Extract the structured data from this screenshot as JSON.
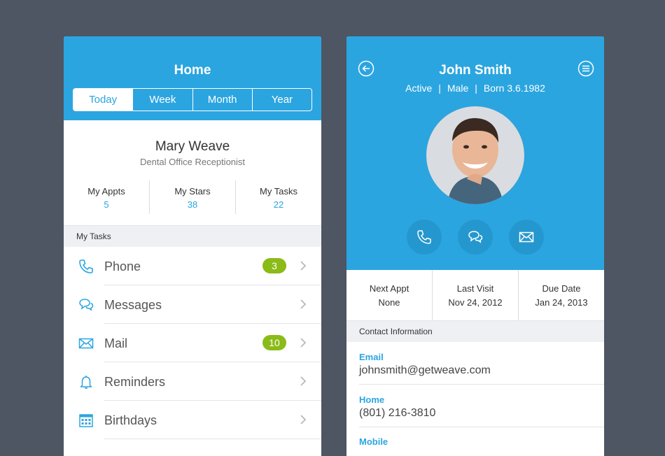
{
  "colors": {
    "background": "#4e5563",
    "accent": "#2ba5e0",
    "badge": "#8bbb18"
  },
  "left": {
    "title": "Home",
    "segments": [
      "Today",
      "Week",
      "Month",
      "Year"
    ],
    "profile": {
      "name": "Mary Weave",
      "role": "Dental Office Receptionist"
    },
    "stats": [
      {
        "label": "My Appts",
        "value": "5"
      },
      {
        "label": "My Stars",
        "value": "38"
      },
      {
        "label": "My Tasks",
        "value": "22"
      }
    ],
    "section_title": "My Tasks",
    "tasks": [
      {
        "icon": "phone-icon",
        "label": "Phone",
        "badge": "3"
      },
      {
        "icon": "messages-icon",
        "label": "Messages",
        "badge": ""
      },
      {
        "icon": "mail-icon",
        "label": "Mail",
        "badge": "10"
      },
      {
        "icon": "bell-icon",
        "label": "Reminders",
        "badge": ""
      },
      {
        "icon": "calendar-icon",
        "label": "Birthdays",
        "badge": ""
      }
    ]
  },
  "right": {
    "name": "John Smith",
    "status": "Active",
    "gender": "Male",
    "born": "Born 3.6.1982",
    "info": [
      {
        "label": "Next Appt",
        "value": "None"
      },
      {
        "label": "Last Visit",
        "value": "Nov 24, 2012"
      },
      {
        "label": "Due Date",
        "value": "Jan 24, 2013"
      }
    ],
    "section_title": "Contact Information",
    "contacts": [
      {
        "label": "Email",
        "value": "johnsmith@getweave.com"
      },
      {
        "label": "Home",
        "value": "(801) 216-3810"
      },
      {
        "label": "Mobile",
        "value": ""
      }
    ]
  }
}
